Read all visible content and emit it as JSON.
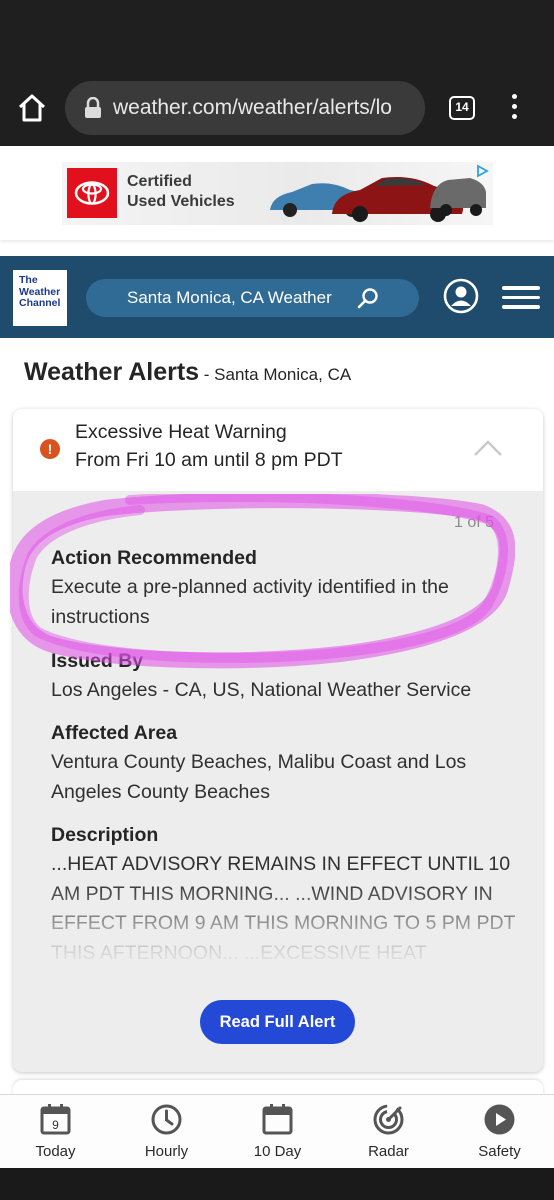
{
  "browser": {
    "url": "weather.com/weather/alerts/lo",
    "tab_count": "14"
  },
  "ad": {
    "headline": "Certified\nUsed Vehicles",
    "logo_color": "#e2101c"
  },
  "header": {
    "logo_lines": [
      "The",
      "Weather",
      "Channel"
    ],
    "search_label": "Santa Monica, CA Weather",
    "brand_color": "#1f4b6d"
  },
  "page": {
    "title": "Weather Alerts",
    "location": " - Santa Monica, CA"
  },
  "alert": {
    "title": "Excessive Heat Warning",
    "time": "From Fri 10 am until 8 pm PDT",
    "counter": "1 of 5",
    "sections": [
      {
        "heading": "Action Recommended",
        "body": "Execute a pre-planned activity identified in the instructions"
      },
      {
        "heading": "Issued By",
        "body": "Los Angeles - CA, US, National Weather Service"
      },
      {
        "heading": "Affected Area",
        "body": "Ventura County Beaches, Malibu Coast and Los Angeles County Beaches"
      }
    ],
    "description_heading": "Description",
    "description": "...HEAT ADVISORY REMAINS IN EFFECT UNTIL 10 AM PDT THIS MORNING... ...WIND ADVISORY IN EFFECT FROM 9 AM THIS MORNING TO 5 PM PDT THIS AFTERNOON... ...EXCESSIVE HEAT WARNING REMAINS IN",
    "read_button": "Read Full Alert",
    "icon_color": "#d9531e",
    "button_color": "#2549d7",
    "highlight_color": "#e04fe6"
  },
  "nav": {
    "items": [
      {
        "label": "Today",
        "icon": "calendar-day-icon",
        "day": "9"
      },
      {
        "label": "Hourly",
        "icon": "clock-icon"
      },
      {
        "label": "10 Day",
        "icon": "calendar-icon"
      },
      {
        "label": "Radar",
        "icon": "radar-icon"
      },
      {
        "label": "Safety",
        "icon": "play-icon"
      }
    ]
  }
}
